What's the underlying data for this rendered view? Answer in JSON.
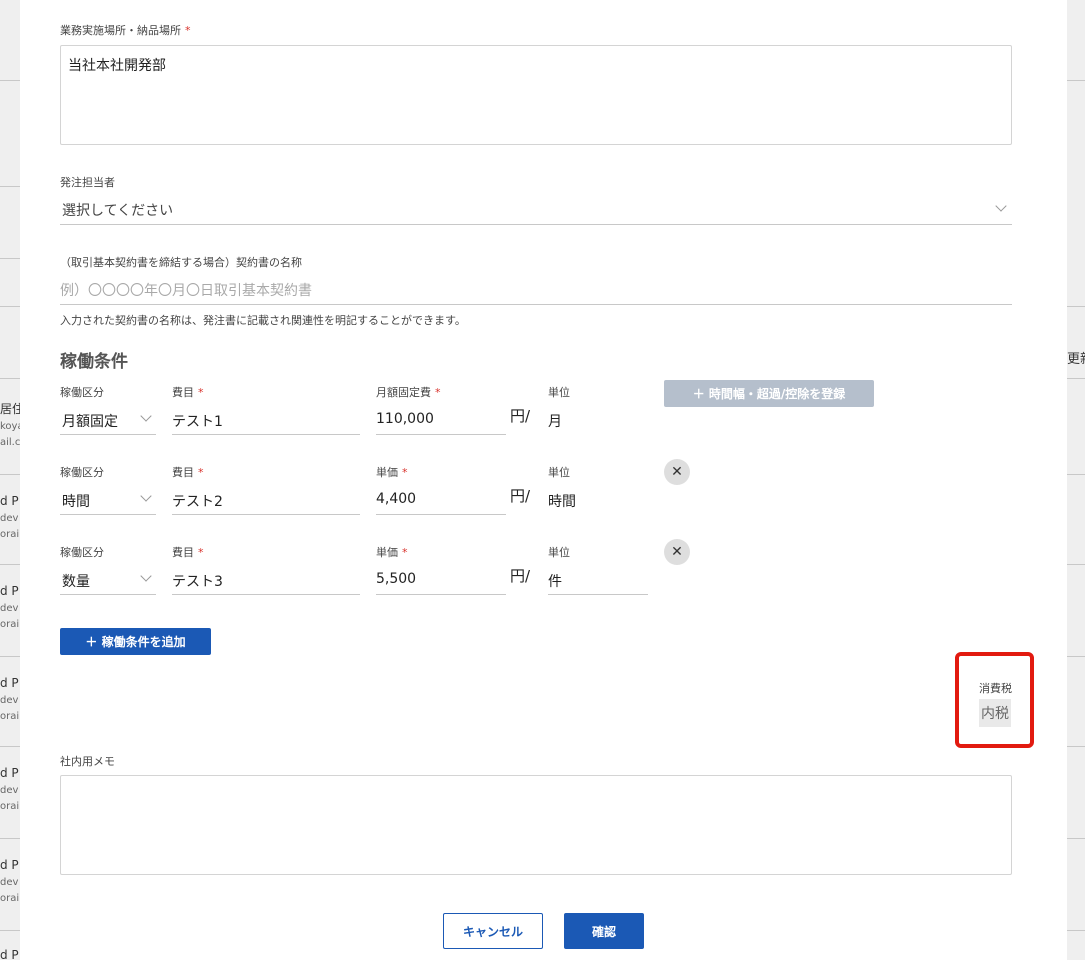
{
  "background": {
    "left_fragments": [
      "居住",
      "koya",
      "ail.c",
      "d P",
      "dev",
      "orai",
      "d P",
      "dev",
      "orai",
      "d P",
      "dev",
      "orai",
      "d P",
      "dev",
      "orai",
      "d P",
      "dev",
      "orai",
      "d P"
    ],
    "right_fragment": "更新"
  },
  "delivery": {
    "label": "業務実施場所・納品場所",
    "required_mark": "*",
    "value": "当社本社開発部"
  },
  "orderer": {
    "label": "発注担当者",
    "value": "選択してください"
  },
  "contract": {
    "label": "（取引基本契約書を締結する場合）契約書の名称",
    "placeholder": "例）〇〇〇〇年〇月〇日取引基本契約書",
    "help": "入力された契約書の名称は、発注書に記載され関連性を明記することができます。"
  },
  "working": {
    "heading": "稼働条件",
    "add_time_button": "＋  時間幅・超過/控除を登録",
    "add_condition_button": "＋  稼働条件を追加",
    "rows": [
      {
        "type_label": "稼働区分",
        "type_value": "月額固定",
        "item_label": "費目",
        "item_value": "テスト1",
        "price_label": "月額固定費",
        "price_value": "110,000",
        "yen": "円/",
        "unit_label": "単位",
        "unit_value": "月"
      },
      {
        "type_label": "稼働区分",
        "type_value": "時間",
        "item_label": "費目",
        "item_value": "テスト2",
        "price_label": "単価",
        "price_value": "4,400",
        "yen": "円/",
        "unit_label": "単位",
        "unit_value": "時間",
        "remove": "✕"
      },
      {
        "type_label": "稼働区分",
        "type_value": "数量",
        "item_label": "費目",
        "item_value": "テスト3",
        "price_label": "単価",
        "price_value": "5,500",
        "yen": "円/",
        "unit_label": "単位",
        "unit_value": "件",
        "remove": "✕"
      }
    ]
  },
  "tax": {
    "label": "消費税",
    "value": "内税"
  },
  "memo": {
    "label": "社内用メモ",
    "value": ""
  },
  "footer": {
    "cancel": "キャンセル",
    "confirm": "確認"
  },
  "colors": {
    "primary": "#1b59b5",
    "required": "#d8322b",
    "highlight": "#e21a10",
    "disabled": "#b5bfcc"
  }
}
